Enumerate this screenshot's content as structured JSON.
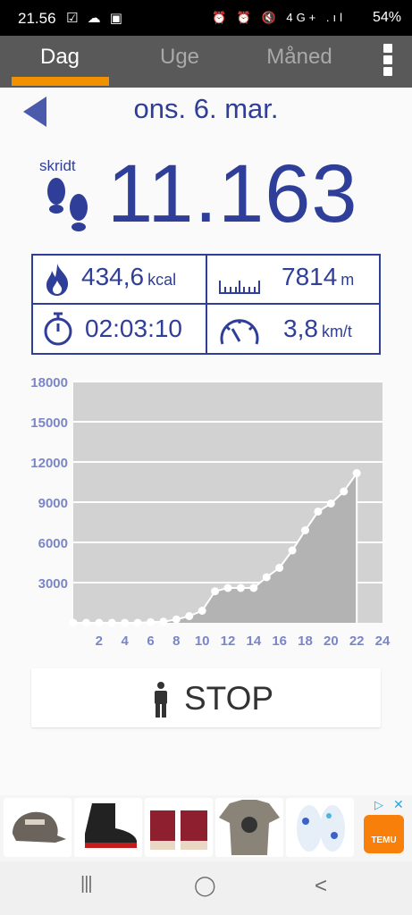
{
  "status_bar": {
    "time": "21.56",
    "left_icons": "☑ ☁ ▣",
    "right_icons": "⏰ ⏰ 🔇 4G+ .ıl",
    "battery": "54%"
  },
  "tabs": [
    {
      "label": "Dag",
      "active": true
    },
    {
      "label": "Uge",
      "active": false
    },
    {
      "label": "Måned",
      "active": false
    }
  ],
  "date_label": "ons. 6. mar.",
  "steps": {
    "label": "skridt",
    "value": "11.163",
    "icon": "footprints-icon"
  },
  "stats": {
    "calories": {
      "value": "434,6",
      "unit": "kcal",
      "icon": "flame-icon"
    },
    "distance": {
      "value": "7814",
      "unit": "m",
      "icon": "ruler-icon"
    },
    "duration": {
      "value": "02:03:10",
      "icon": "stopwatch-icon"
    },
    "speed": {
      "value": "3,8",
      "unit": "km/t",
      "icon": "speedometer-icon"
    }
  },
  "chart_data": {
    "type": "area",
    "x": [
      0,
      1,
      2,
      3,
      4,
      5,
      6,
      7,
      8,
      9,
      10,
      11,
      12,
      13,
      14,
      15,
      16,
      17,
      18,
      19,
      20,
      21,
      22
    ],
    "values": [
      0,
      0,
      0,
      0,
      0,
      0,
      50,
      80,
      250,
      500,
      900,
      2350,
      2600,
      2600,
      2600,
      3400,
      4100,
      5400,
      6900,
      8300,
      8900,
      9800,
      11163
    ],
    "xticks": [
      "2",
      "4",
      "6",
      "8",
      "10",
      "12",
      "14",
      "16",
      "18",
      "20",
      "22",
      "24"
    ],
    "yticks": [
      "3000",
      "6000",
      "9000",
      "12000",
      "15000",
      "18000"
    ],
    "xlim": [
      0,
      24
    ],
    "ylim": [
      0,
      18000
    ],
    "title": "",
    "xlabel": "",
    "ylabel": "",
    "grid": true,
    "colors": {
      "plot_bg": "#d2d2d2",
      "area": "#b3b3b3",
      "line": "#ffffff",
      "labels": "#7a86c8"
    }
  },
  "stop_button": {
    "label": "STOP",
    "icon": "person-icon"
  },
  "ad": {
    "items": [
      "cap",
      "rain-boot",
      "slippers",
      "t-shirt",
      "kids-shoes"
    ],
    "brand": "TEMU",
    "choices_icon": "▷",
    "close_icon": "✕"
  },
  "navbar": {
    "recent": "|||",
    "home": "◯",
    "back": "<"
  }
}
